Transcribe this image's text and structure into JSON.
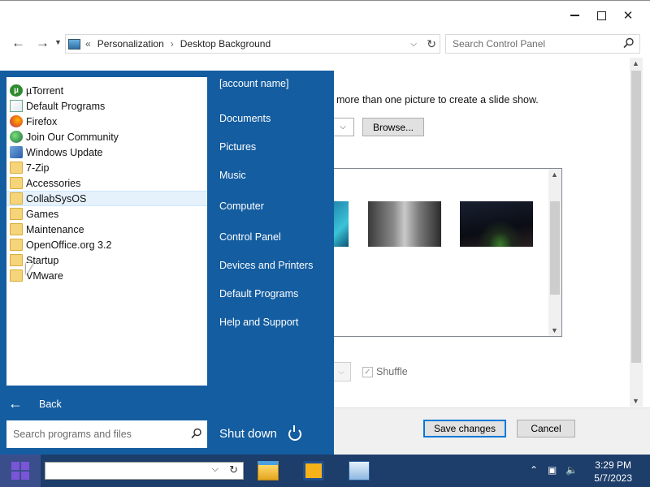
{
  "window": {
    "address": {
      "overflow": "«",
      "crumbs": [
        "Personalization",
        "Desktop Background"
      ]
    },
    "search_placeholder": "Search Control Panel",
    "instructions": "more than one picture to create a slide show.",
    "browse_label": "Browse...",
    "shuffle_label": "Shuffle",
    "shuffle_checked": true,
    "save_label": "Save changes",
    "cancel_label": "Cancel"
  },
  "startmenu": {
    "programs": [
      {
        "label": "µTorrent",
        "icon": "utorrent-icon"
      },
      {
        "label": "Default Programs",
        "icon": "default-programs-icon"
      },
      {
        "label": "Firefox",
        "icon": "firefox-icon"
      },
      {
        "label": "Join Our Community",
        "icon": "globe-icon"
      },
      {
        "label": "Windows Update",
        "icon": "windows-update-icon"
      },
      {
        "label": "7-Zip",
        "icon": "folder-icon"
      },
      {
        "label": "Accessories",
        "icon": "folder-icon"
      },
      {
        "label": "CollabSysOS",
        "icon": "folder-icon"
      },
      {
        "label": "Games",
        "icon": "folder-icon"
      },
      {
        "label": "Maintenance",
        "icon": "folder-icon"
      },
      {
        "label": "OpenOffice.org 3.2",
        "icon": "folder-icon"
      },
      {
        "label": "Startup",
        "icon": "folder-icon"
      },
      {
        "label": "VMware",
        "icon": "folder-icon"
      }
    ],
    "back_label": "Back",
    "search_placeholder": "Search programs and files",
    "username": "[account name]",
    "right_items": [
      "Documents",
      "Pictures",
      "Music",
      "Computer",
      "Control Panel",
      "Devices and Printers",
      "Default Programs",
      "Help and Support"
    ],
    "shutdown_label": "Shut down"
  },
  "taskbar": {
    "time": "3:29 PM",
    "date": "5/7/2023"
  },
  "colors": {
    "start_menu_bg": "#145da0",
    "taskbar_bg": "#1d3d6a",
    "selection": "#e5f1fb"
  }
}
